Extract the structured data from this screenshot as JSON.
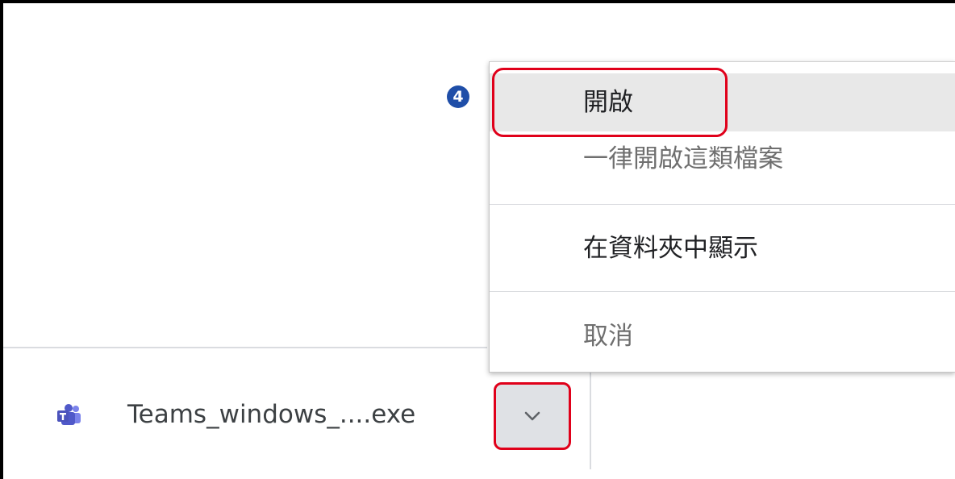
{
  "step": {
    "number": "4"
  },
  "context_menu": {
    "items": [
      {
        "label": "開啟"
      },
      {
        "label": "一律開啟這類檔案"
      },
      {
        "label": "在資料夾中顯示"
      },
      {
        "label": "取消"
      }
    ]
  },
  "download_shelf": {
    "file_name": "Teams_windows_....exe",
    "file_icon": "teams-icon",
    "dropdown_icon": "chevron-down-icon"
  },
  "colors": {
    "highlight": "#e0001a",
    "badge": "#1f4ea8",
    "teams": "#5059c9"
  }
}
